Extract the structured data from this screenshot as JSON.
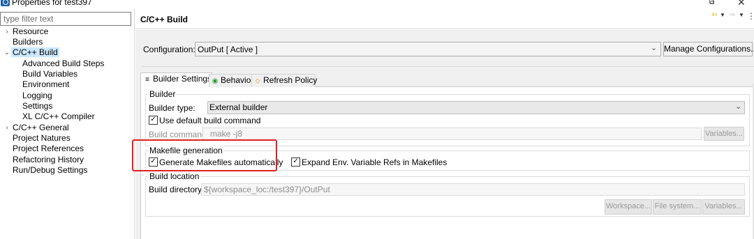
{
  "window": {
    "title": "Properties for test397",
    "restore_glyph": "⧉",
    "close_glyph": "✕"
  },
  "filter": {
    "placeholder": "type filter text"
  },
  "tree": {
    "items": [
      {
        "label": "Resource",
        "expandable": true
      },
      {
        "label": "Builders"
      },
      {
        "label": "C/C++ Build",
        "expanded": true,
        "selected": true
      },
      {
        "label": "Advanced Build Steps"
      },
      {
        "label": "Build Variables"
      },
      {
        "label": "Environment"
      },
      {
        "label": "Logging"
      },
      {
        "label": "Settings"
      },
      {
        "label": "XL C/C++ Compiler"
      },
      {
        "label": "C/C++ General",
        "expandable": true
      },
      {
        "label": "Project Natures"
      },
      {
        "label": "Project References"
      },
      {
        "label": "Refactoring History"
      },
      {
        "label": "Run/Debug Settings"
      }
    ]
  },
  "page": {
    "title": "C/C++ Build",
    "configuration_label": "Configuration:",
    "configuration_value": "OutPut  [ Active ]",
    "manage_button": "Manage Configurations..."
  },
  "tabs": {
    "builder_settings": "Builder Settings",
    "behavior": "Behavior",
    "refresh_policy": "Refresh Policy"
  },
  "builder": {
    "group_title": "Builder",
    "type_label": "Builder type:",
    "type_value": "External builder",
    "use_default_label": "Use default build command",
    "use_default_checked": true,
    "command_label": "Build command:",
    "command_value": "make -j8",
    "variables_button": "Variables..."
  },
  "makefile": {
    "group_title": "Makefile generation",
    "generate_label": "Generate Makefiles automatically",
    "generate_checked": true,
    "expand_label": "Expand Env. Variable Refs in Makefiles",
    "expand_checked": true
  },
  "location": {
    "group_title": "Build location",
    "directory_label": "Build directory:",
    "directory_value": "${workspace_loc:/test397}/OutPut",
    "workspace_button": "Workspace...",
    "filesystem_button": "File system...",
    "variables_button": "Variables..."
  },
  "colors": {
    "highlight": "#e02020",
    "selection": "#cce8ff"
  },
  "icons": {
    "app": "cdt-icon",
    "nav_back": "yellow-arrow-left-icon",
    "nav_forward": "gray-arrow-right-icon",
    "view_menu": "view-menu-icon",
    "tab_builder": "list-icon",
    "tab_behavior": "green-dot-icon",
    "tab_refresh": "refresh-key-icon"
  }
}
